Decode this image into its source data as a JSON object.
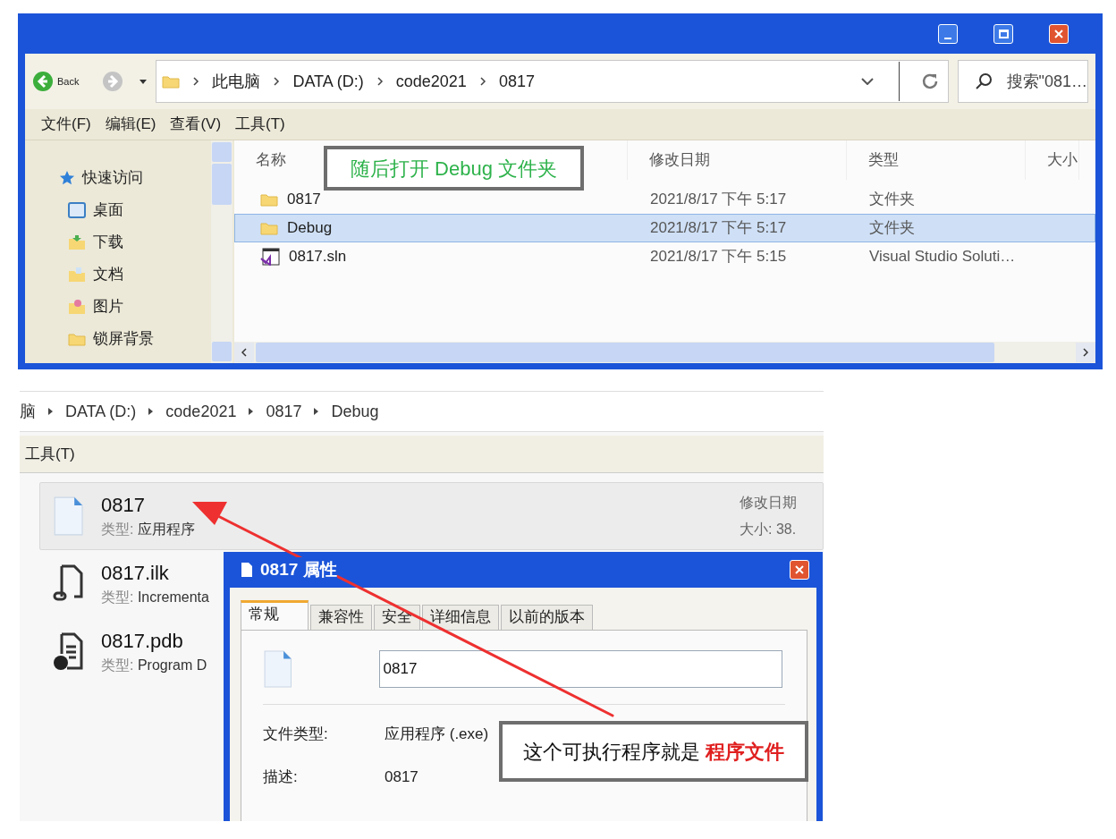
{
  "explorer": {
    "back_label": "Back",
    "breadcrumb": [
      "此电脑",
      "DATA (D:)",
      "code2021",
      "0817"
    ],
    "search_placeholder": "搜索\"081…",
    "menu": [
      "文件(F)",
      "编辑(E)",
      "查看(V)",
      "工具(T)"
    ],
    "sidebar": [
      {
        "label": "快速访问",
        "kind": "star"
      },
      {
        "label": "桌面",
        "kind": "desktop"
      },
      {
        "label": "下载",
        "kind": "download"
      },
      {
        "label": "文档",
        "kind": "documents"
      },
      {
        "label": "图片",
        "kind": "pictures"
      },
      {
        "label": "锁屏背景",
        "kind": "folder"
      }
    ],
    "columns": [
      "名称",
      "修改日期",
      "类型",
      "大小"
    ],
    "rows": [
      {
        "name": "0817",
        "date": "2021/8/17 下午 5:17",
        "type": "文件夹",
        "kind": "folder",
        "selected": false
      },
      {
        "name": "Debug",
        "date": "2021/8/17 下午 5:17",
        "type": "文件夹",
        "kind": "folder",
        "selected": true
      },
      {
        "name": "0817.sln",
        "date": "2021/8/17 下午 5:15",
        "type": "Visual Studio Soluti…",
        "kind": "solution",
        "selected": false
      }
    ],
    "note": "随后打开 Debug 文件夹"
  },
  "debug_folder": {
    "breadcrumb": [
      "脑",
      "DATA (D:)",
      "code2021",
      "0817",
      "Debug"
    ],
    "menu": [
      "工具(T)"
    ],
    "files": [
      {
        "name": "0817",
        "type_label": "类型:",
        "type": "应用程序",
        "kind": "exe",
        "selected": true,
        "modified_label": "修改日期",
        "size": "大小: 38."
      },
      {
        "name": "0817.ilk",
        "type_label": "类型:",
        "type": "Incrementa",
        "kind": "link",
        "selected": false
      },
      {
        "name": "0817.pdb",
        "type_label": "类型:",
        "type": "Program D",
        "kind": "pdb",
        "selected": false
      }
    ],
    "dialog": {
      "title": "0817 属性",
      "tabs": [
        {
          "label": "常规",
          "selected": true
        },
        {
          "label": "兼容性",
          "selected": false
        },
        {
          "label": "安全",
          "selected": false
        },
        {
          "label": "详细信息",
          "selected": false
        },
        {
          "label": "以前的版本",
          "selected": false
        }
      ],
      "name_value": "0817",
      "fields": [
        {
          "label": "文件类型:",
          "value": "应用程序 (.exe)"
        },
        {
          "label": "描述:",
          "value": "0817"
        }
      ]
    },
    "note": "这个可执行程序就是 **程序文件**"
  }
}
